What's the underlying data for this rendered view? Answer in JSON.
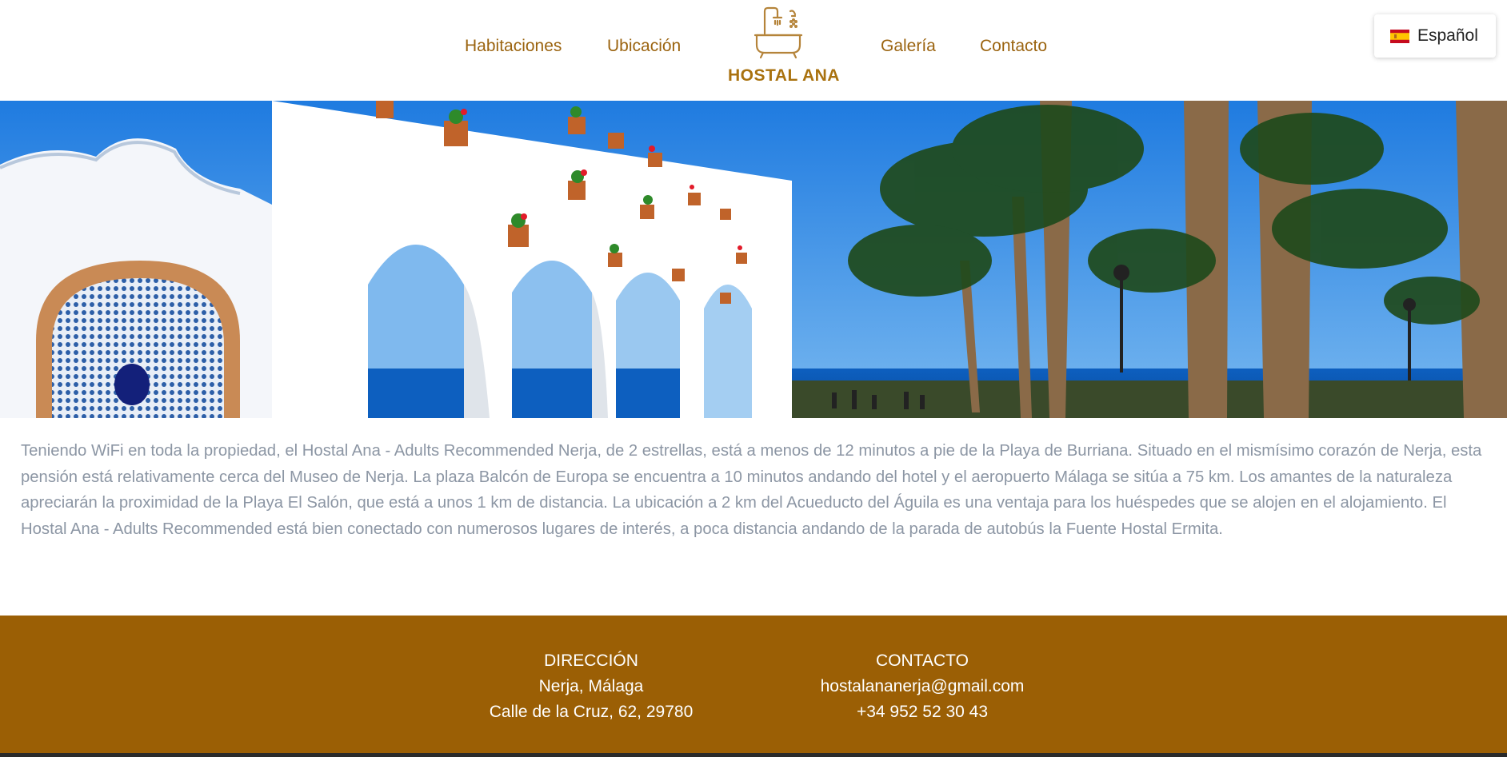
{
  "nav": {
    "links": [
      "Habitaciones",
      "Ubicación",
      "Galería",
      "Contacto"
    ],
    "logo_icon": "bathtub-shower-icon",
    "logo_text": "HOSTAL ANA"
  },
  "language": {
    "label": "Español",
    "flag_icon": "spain-flag-icon"
  },
  "hero": {
    "image": "Nerja white arches with flower pots, sea and palm trees"
  },
  "description": "Teniendo WiFi en toda la propiedad, el Hostal Ana - Adults Recommended Nerja, de 2 estrellas, está a menos de 12 minutos a pie de la Playa de Burriana. Situado en el mismísimo corazón de Nerja, esta pensión está relativamente cerca del Museo de Nerja. La plaza Balcón de Europa se encuentra a 10 minutos andando del hotel y el aeropuerto Málaga se sitúa a 75 km. Los amantes de la naturaleza apreciarán la proximidad de la Playa El Salón, que está a unos 1 km de distancia. La ubicación a 2 km del Acueducto del Águila es una ventaja para los huéspedes que se alojen en el alojamiento. El Hostal Ana - Adults Recommended está bien conectado con numerosos lugares de interés, a poca distancia andando de la parada de autobús la Fuente Hostal Ermita.",
  "footer": {
    "address": {
      "title": "DIRECCIÓN",
      "city": "Nerja, Málaga",
      "street": "Calle de la Cruz, 62, 29780"
    },
    "contact": {
      "title": "CONTACTO",
      "email": "hostalananerja@gmail.com",
      "phone": "+34 952 52 30 43"
    }
  },
  "colors": {
    "accent": "#9b6410",
    "logo": "#a9720f",
    "footer_bg": "#9b5f05",
    "body_text": "#8c96a4"
  }
}
